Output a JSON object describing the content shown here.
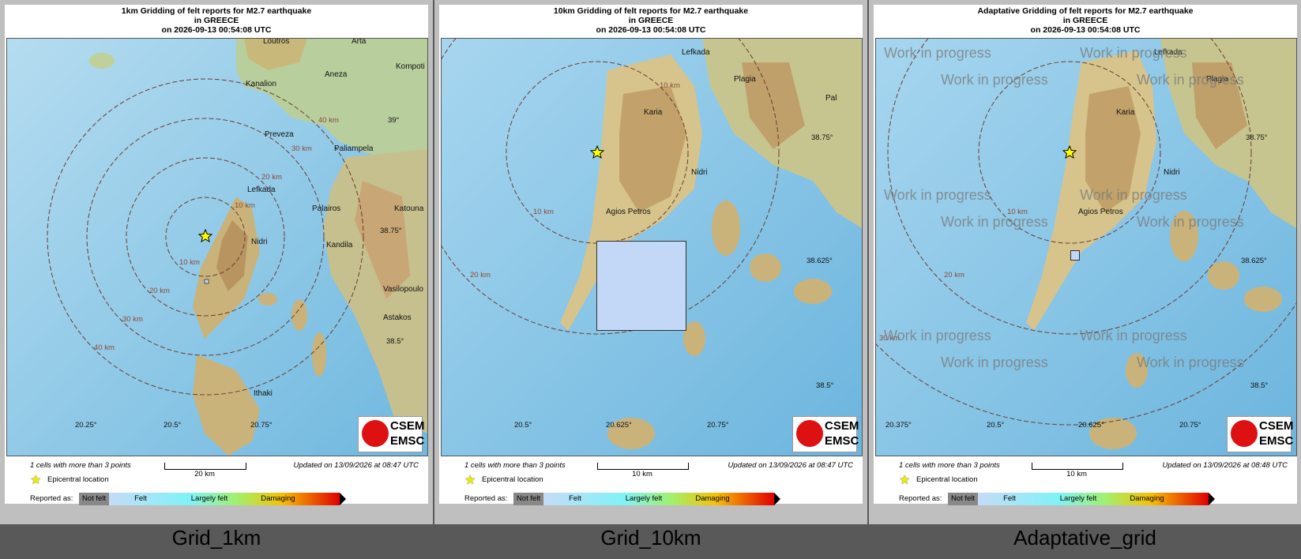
{
  "panels": [
    {
      "title_line1": "1km Gridding of felt reports for M2.7 earthquake",
      "title_line2": "in GREECE",
      "title_line3": "on 2026-09-13 00:54:08 UTC",
      "cities": [
        "Loutros",
        "Arta",
        "Kompoti",
        "Kanalion",
        "Aneza",
        "Preveza",
        "Paliampela",
        "Lefkada",
        "Palairos",
        "Katouna",
        "Nidri",
        "Kandila",
        "Vasilopoulo",
        "Astakos",
        "Ithaki"
      ],
      "radius_labels": [
        "40 km",
        "30 km",
        "20 km",
        "10 km",
        "10 km",
        "20 km",
        "30 km",
        "40 km"
      ],
      "lat_ticks": [
        "39°",
        "38.75°",
        "38.5°"
      ],
      "lon_ticks": [
        "20.25°",
        "20.5°",
        "20.75°"
      ],
      "cells_text": "1 cells with more than 3 points",
      "scale_label": "20 km",
      "updated": "Updated on 13/09/2026 at 08:47 UTC",
      "caption": "Grid_1km"
    },
    {
      "title_line1": "10km Gridding of felt reports for M2.7 earthquake",
      "title_line2": "in GREECE",
      "title_line3": "on 2026-09-13 00:54:08 UTC",
      "cities": [
        "Lefkada",
        "Plagia",
        "Pal",
        "Karia",
        "Nidri",
        "Agios Petros"
      ],
      "radius_labels": [
        "10 km",
        "10 km",
        "20 km"
      ],
      "lat_ticks": [
        "38.75°",
        "38.625°",
        "38.5°"
      ],
      "lon_ticks": [
        "20.5°",
        "20.625°",
        "20.75°"
      ],
      "cells_text": "1 cells with more than 3 points",
      "scale_label": "10 km",
      "updated": "Updated on 13/09/2026 at 08:47 UTC",
      "caption": "Grid_10km"
    },
    {
      "title_line1": "Adaptative Gridding of felt reports for M2.7 earthquake",
      "title_line2": "in GREECE",
      "title_line3": "on 2026-09-13 00:54:08 UTC",
      "cities": [
        "Lefkada",
        "Plagia",
        "Karia",
        "Nidri",
        "Agios Petros"
      ],
      "radius_labels": [
        "10 km",
        "20 km",
        "30 km"
      ],
      "lat_ticks": [
        "38.75°",
        "38.625°",
        "38.5°"
      ],
      "lon_ticks": [
        "20.375°",
        "20.5°",
        "20.625°",
        "20.75°"
      ],
      "cells_text": "1 cells with more than 3 points",
      "scale_label": "10 km",
      "updated": "Updated on 13/09/2026 at 08:48 UTC",
      "caption": "Adaptative_grid",
      "watermark": "Work in progress"
    }
  ],
  "legend": {
    "epicentral": "Epicentral location",
    "reported_as": "Reported as:",
    "levels": [
      "Not felt",
      "Felt",
      "Largely felt",
      "Damaging"
    ]
  },
  "logo": {
    "line1": "CSEM",
    "line2": "EMSC"
  }
}
